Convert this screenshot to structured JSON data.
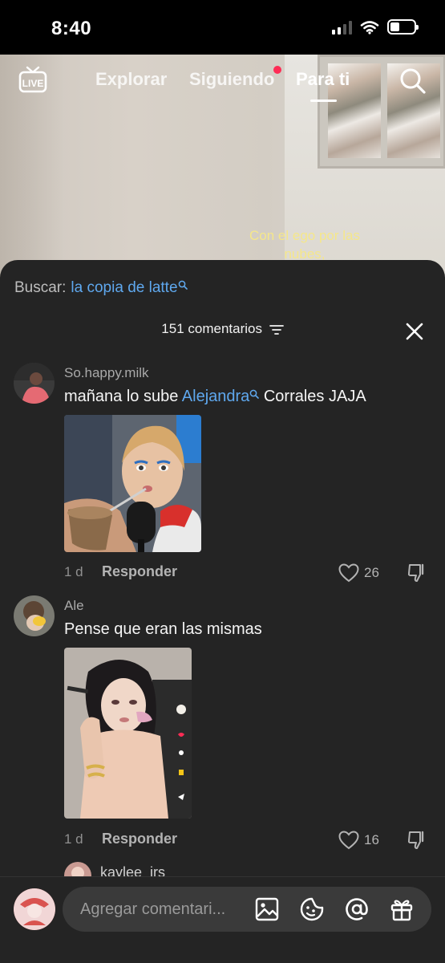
{
  "status_bar": {
    "time": "8:40"
  },
  "top_nav": {
    "tabs": [
      {
        "label": "Explorar"
      },
      {
        "label": "Siguiendo"
      },
      {
        "label": "Para ti"
      }
    ],
    "live_label": "LIVE"
  },
  "video": {
    "caption": "Con el ego por las nubes,"
  },
  "sheet": {
    "search_prefix": "Buscar:",
    "search_term": "la copia de latte",
    "comment_count_label": "151 comentarios"
  },
  "comments": [
    {
      "username": "So.happy.milk",
      "text_before": "mañana lo sube ",
      "mention": "Alejandra",
      "text_after": " Corrales JAJA",
      "age": "1 d",
      "reply_label": "Responder",
      "likes": "26"
    },
    {
      "username": "Ale",
      "text": "Pense que eran las mismas",
      "age": "1 d",
      "reply_label": "Responder",
      "likes": "16"
    },
    {
      "username": "kaylee_irs"
    }
  ],
  "bottom_bar": {
    "placeholder": "Agregar comentari..."
  },
  "colors": {
    "accent_link": "#5fa8ee",
    "notification": "#fe2c55",
    "sheet_bg": "#242424",
    "caption": "#f5e78a"
  }
}
